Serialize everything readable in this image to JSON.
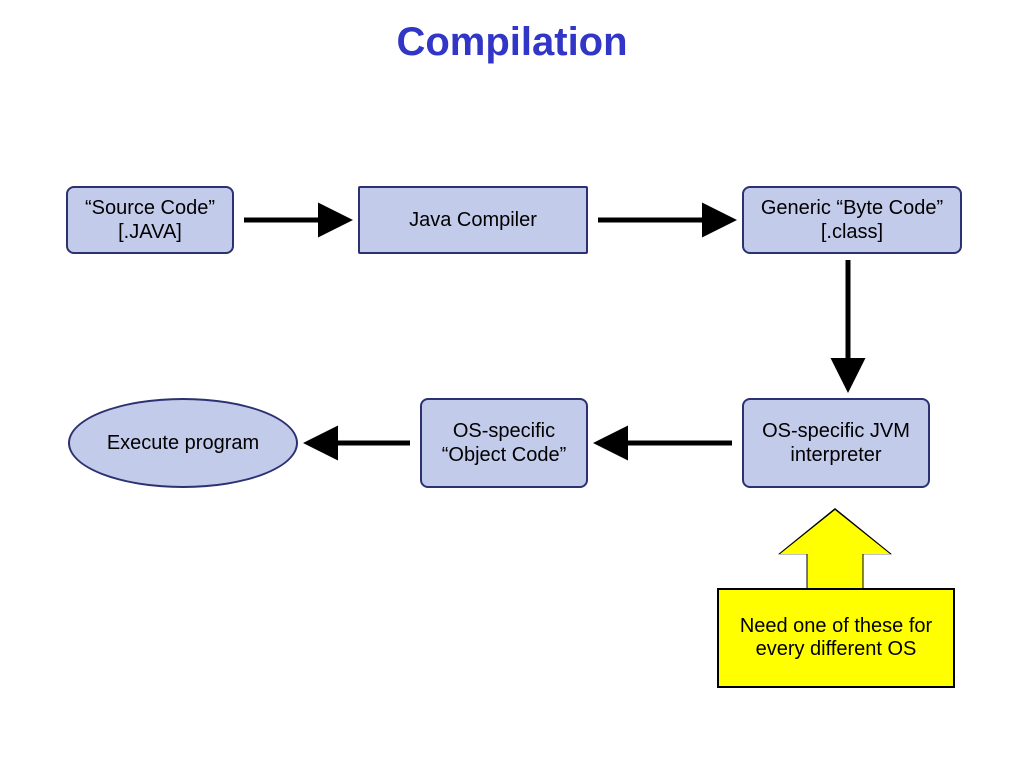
{
  "title": "Compilation",
  "nodes": {
    "source": "“Source Code” [.JAVA]",
    "compiler": "Java Compiler",
    "bytecode": "Generic “Byte Code” [.class]",
    "jvm": "OS-specific JVM interpreter",
    "object": "OS-specific “Object Code”",
    "execute": "Execute program"
  },
  "callout": "Need one of these for every different OS",
  "chart_data": {
    "type": "diagram",
    "title": "Compilation",
    "nodes": [
      {
        "id": "source",
        "shape": "rect",
        "label": "“Source Code” [.JAVA]"
      },
      {
        "id": "compiler",
        "shape": "rect",
        "label": "Java Compiler"
      },
      {
        "id": "bytecode",
        "shape": "rect",
        "label": "Generic “Byte Code” [.class]"
      },
      {
        "id": "jvm",
        "shape": "rect",
        "label": "OS-specific JVM interpreter"
      },
      {
        "id": "object",
        "shape": "rect",
        "label": "OS-specific “Object Code”"
      },
      {
        "id": "execute",
        "shape": "ellipse",
        "label": "Execute program"
      }
    ],
    "edges": [
      {
        "from": "source",
        "to": "compiler"
      },
      {
        "from": "compiler",
        "to": "bytecode"
      },
      {
        "from": "bytecode",
        "to": "jvm"
      },
      {
        "from": "jvm",
        "to": "object"
      },
      {
        "from": "object",
        "to": "execute"
      }
    ],
    "annotations": [
      {
        "target": "jvm",
        "text": "Need one of these for every different OS",
        "style": "callout-arrow-up"
      }
    ]
  }
}
